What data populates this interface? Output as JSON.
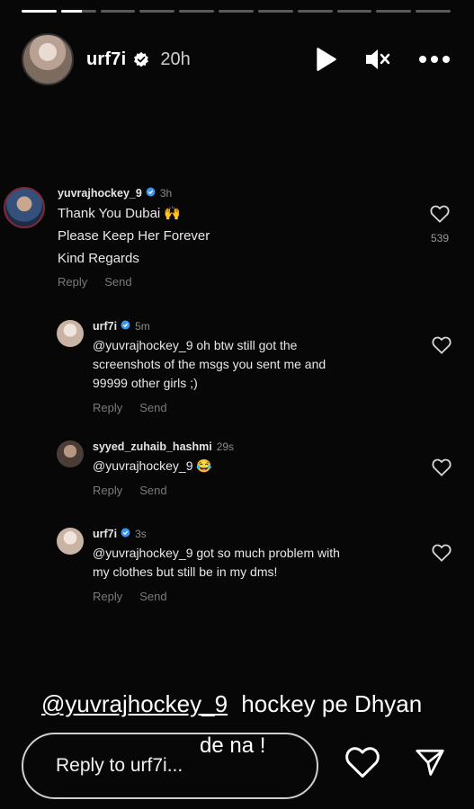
{
  "progress": {
    "total_segments": 11,
    "current_segment": 2,
    "current_fill": 0.6
  },
  "header": {
    "username": "urf7i",
    "time": "20h",
    "icons": {
      "verified": "verified-badge-icon",
      "play": "play-icon",
      "mute": "mute-icon",
      "more": "more-icon"
    }
  },
  "comments": [
    {
      "username": "yuvrajhockey_9",
      "time": "3h",
      "text_lines": [
        "Thank You Dubai 🙌",
        "Please Keep Her Forever",
        "Kind Regards"
      ],
      "likes": "539",
      "reply_label": "Reply",
      "send_label": "Send"
    },
    {
      "username": "urf7i",
      "time": "5m",
      "text_lines": [
        "@yuvrajhockey_9 oh btw still got the",
        "screenshots of the msgs you sent me and",
        "99999 other girls ;)"
      ],
      "reply_label": "Reply",
      "send_label": "Send"
    },
    {
      "username": "syyed_zuhaib_hashmi",
      "time": "29s",
      "text_lines": [
        "@yuvrajhockey_9 😂"
      ],
      "reply_label": "Reply",
      "send_label": "Send"
    },
    {
      "username": "urf7i",
      "time": "3s",
      "text_lines": [
        "@yuvrajhockey_9 got so much problem with",
        "my clothes but still be in my dms!"
      ],
      "reply_label": "Reply",
      "send_label": "Send"
    }
  ],
  "overlay": {
    "mention": "@yuvrajhockey_9",
    "line1_rest": "hockey pe Dhyan",
    "line2": "de na !"
  },
  "footer": {
    "reply_placeholder": "Reply to urf7i...",
    "icons": {
      "like": "heart-icon",
      "share": "send-icon"
    }
  }
}
